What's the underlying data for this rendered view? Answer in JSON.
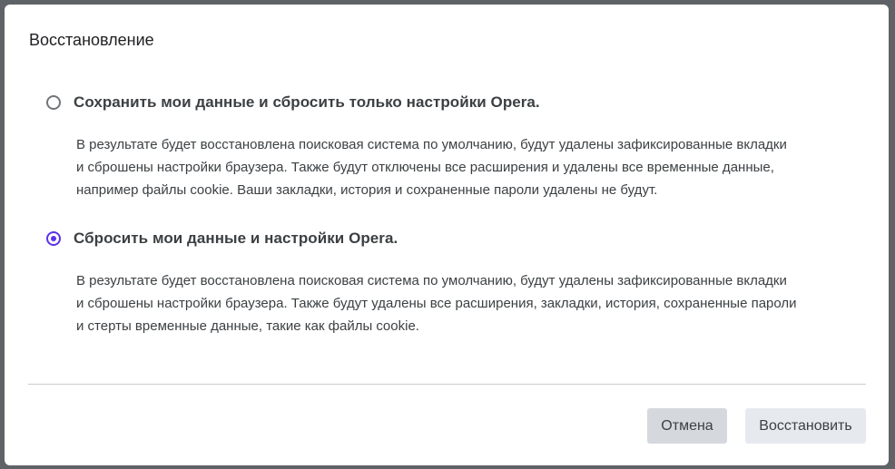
{
  "dialog": {
    "title": "Восстановление",
    "options": [
      {
        "label": "Сохранить мои данные и сбросить только настройки Opera.",
        "checked": false,
        "description": [
          "В результате будет восстановлена поисковая система по умолчанию, будут удалены зафиксированные вкладки",
          "и сброшены настройки браузера. Также будут отключены все расширения и удалены все временные данные,",
          "например файлы cookie. Ваши закладки, история и сохраненные пароли удалены не будут."
        ]
      },
      {
        "label": "Сбросить мои данные и настройки Opera.",
        "checked": true,
        "description": [
          "В результате будет восстановлена поисковая система по умолчанию, будут удалены зафиксированные вкладки",
          "и сброшены настройки браузера. Также будут удалены все расширения, закладки, история, сохраненные пароли",
          "и стерты временные данные, такие как файлы cookie."
        ]
      }
    ],
    "buttons": {
      "cancel_label": "Отмена",
      "restore_label": "Восстановить"
    }
  },
  "colors": {
    "accent": "#5b31e9",
    "backdrop": "#5f6368",
    "cancel_bg": "#d5d8dc",
    "restore_bg": "#e6eaef"
  }
}
